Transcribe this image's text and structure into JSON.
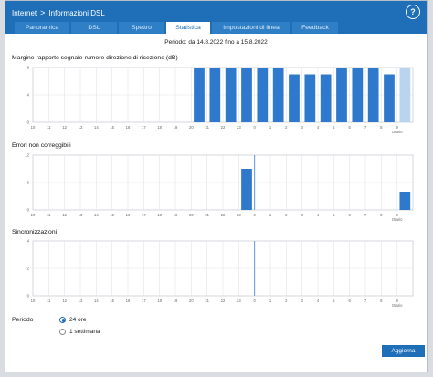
{
  "header": {
    "breadcrumb": [
      "Internet",
      "Informazioni DSL"
    ],
    "breadcrumb_separator": ">",
    "help_label": "?",
    "color": "#1e6fb8"
  },
  "tabs": [
    {
      "label": "Panoramica",
      "active": false
    },
    {
      "label": "DSL",
      "active": false
    },
    {
      "label": "Spettro",
      "active": false
    },
    {
      "label": "Statistica",
      "active": true
    },
    {
      "label": "Impostazioni di linea",
      "active": false
    },
    {
      "label": "Feedback",
      "active": false
    }
  ],
  "period_title": "Periodo: da 14.8.2022 fino a 15.8.2022",
  "charts": [
    {
      "title": "Margine rapporto segnale-rumore direzione di ricezione (dB)",
      "chart_data": {
        "type": "bar",
        "categories": [
          "10",
          "11",
          "12",
          "13",
          "14",
          "15",
          "16",
          "17",
          "18",
          "19",
          "20",
          "21",
          "22",
          "23",
          "0",
          "1",
          "2",
          "3",
          "4",
          "5",
          "6",
          "7",
          "8",
          "9"
        ],
        "values": [
          0,
          0,
          0,
          0,
          0,
          0,
          0,
          0,
          0,
          0,
          8,
          8,
          8,
          8,
          8,
          8,
          7,
          7,
          7,
          8,
          8,
          8,
          7,
          8
        ],
        "ylim": [
          0,
          8
        ],
        "yticks": [
          "0",
          "4",
          "8"
        ],
        "x_end_label": "Orario",
        "current_hour_index": 23
      }
    },
    {
      "title": "Errori non correggibili",
      "chart_data": {
        "type": "bar",
        "categories": [
          "10",
          "11",
          "12",
          "13",
          "14",
          "15",
          "16",
          "17",
          "18",
          "19",
          "20",
          "21",
          "22",
          "23",
          "0",
          "1",
          "2",
          "3",
          "4",
          "5",
          "6",
          "7",
          "8",
          "9"
        ],
        "values": [
          0,
          0,
          0,
          0,
          0,
          0,
          0,
          0,
          0,
          0,
          0,
          0,
          0,
          9,
          0,
          0,
          0,
          0,
          0,
          0,
          0,
          0,
          0,
          4
        ],
        "ylim": [
          0,
          12
        ],
        "yticks": [
          "0",
          "6",
          "12"
        ],
        "x_end_label": "Orario",
        "marker_index": 14
      }
    },
    {
      "title": "Sincronizzazioni",
      "chart_data": {
        "type": "bar",
        "categories": [
          "10",
          "11",
          "12",
          "13",
          "14",
          "15",
          "16",
          "17",
          "18",
          "19",
          "20",
          "21",
          "22",
          "23",
          "0",
          "1",
          "2",
          "3",
          "4",
          "5",
          "6",
          "7",
          "8",
          "9"
        ],
        "values": [
          0,
          0,
          0,
          0,
          0,
          0,
          0,
          0,
          0,
          0,
          0,
          0,
          0,
          0,
          0,
          0,
          0,
          0,
          0,
          0,
          0,
          0,
          0,
          0
        ],
        "ylim": [
          0,
          4
        ],
        "yticks": [
          "0",
          "2",
          "4"
        ],
        "x_end_label": "Orario",
        "marker_index": 14
      }
    }
  ],
  "period_options": {
    "label": "Periodo",
    "options": [
      {
        "label": "24 ore",
        "selected": true
      },
      {
        "label": "1 settimana",
        "selected": false
      }
    ]
  },
  "refresh_label": "Aggiorna"
}
